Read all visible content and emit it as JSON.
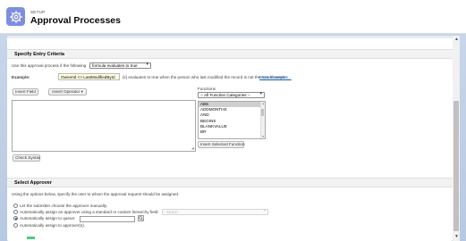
{
  "header": {
    "setup_label": "SETUP",
    "title": "Approval Processes"
  },
  "entry_criteria": {
    "section_title": "Specify Entry Criteria",
    "intro_text": "Use this approval process if the following",
    "criteria_select": "formula evaluates to true",
    "example_label": "Example:",
    "example_formula": "OwnerId <> LastModifiedById",
    "example_desc": "(ii) evaluates to true when the person who last modified the record is not the record owner.",
    "more_examples_link": "More Examples...",
    "insert_field_button": "Insert Field",
    "insert_operator_button": "Insert Operator",
    "functions_label": "Functions",
    "function_category_select": "-- All Function Categories --",
    "functions": [
      "ABS",
      "ADDMONTHS",
      "AND",
      "BEGINS",
      "BLANKVALUE",
      "BR"
    ],
    "selected_function": "ABS",
    "insert_selected_function_button": "Insert Selected Function",
    "check_syntax_button": "Check Syntax"
  },
  "select_approver": {
    "section_title": "Select Approver",
    "intro_text": "Using the options below, specify the user to whom the approval request should be assigned.",
    "options": [
      "Let the submitter choose the approver manually.",
      "Automatically assign an approver using a standard or custom hierarchy field:",
      "Automatically assign to queue:",
      "Automatically assign to approver(s)."
    ],
    "selected_option_index": 2,
    "hierarchy_select": "--None--"
  },
  "colors": {
    "accent": "#7f8de1",
    "link": "#0b5cab",
    "example_bg": "#fffde0"
  }
}
